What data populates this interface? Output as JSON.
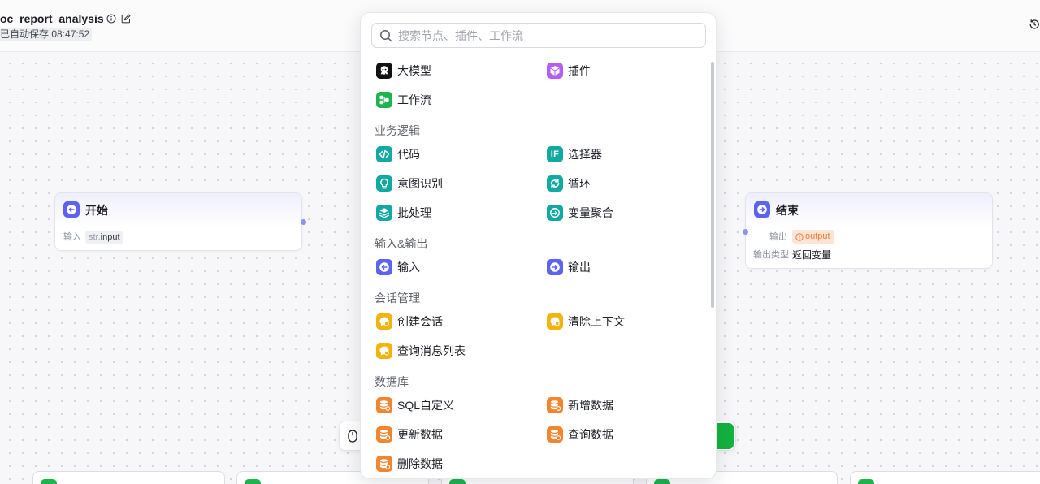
{
  "header": {
    "title": "oc_report_analysis",
    "autosave": "已自动保存 08:47:52",
    "icons": [
      "info-icon",
      "edit-icon",
      "history-icon"
    ]
  },
  "colors": {
    "llm": "#111111",
    "plugin": "#b65ef2",
    "workflow": "#1db34f",
    "logic": "#12a8a4",
    "io": "#5d62f0",
    "conversation": "#f2b30d",
    "database": "#f2852e",
    "run_button": "#12b33f",
    "warning": "#ef7b33"
  },
  "canvas": {
    "start_node": {
      "title": "开始",
      "input_label": "输入",
      "input_type": "str.",
      "input_name": "input"
    },
    "end_node": {
      "title": "结束",
      "output_label": "输出",
      "output_var": "output",
      "output_type_label": "输出类型",
      "output_type_value": "返回变量"
    },
    "toolbar_icons": [
      "mouse-icon"
    ]
  },
  "node_picker": {
    "search_placeholder": "搜索节点、插件、工作流",
    "top_items": [
      {
        "label": "大模型",
        "icon": "llm-icon"
      },
      {
        "label": "插件",
        "icon": "plugin-icon"
      },
      {
        "label": "工作流",
        "icon": "workflow-icon"
      }
    ],
    "sections": [
      {
        "title": "业务逻辑",
        "items": [
          {
            "label": "代码",
            "icon": "code-icon"
          },
          {
            "label": "选择器",
            "icon": "if-selector-icon",
            "icon_text": "IF"
          },
          {
            "label": "意图识别",
            "icon": "intent-icon"
          },
          {
            "label": "循环",
            "icon": "loop-icon"
          },
          {
            "label": "批处理",
            "icon": "batch-icon"
          },
          {
            "label": "变量聚合",
            "icon": "variable-merge-icon"
          }
        ]
      },
      {
        "title": "输入&输出",
        "items": [
          {
            "label": "输入",
            "icon": "input-icon"
          },
          {
            "label": "输出",
            "icon": "output-icon"
          }
        ]
      },
      {
        "title": "会话管理",
        "items": [
          {
            "label": "创建会话",
            "icon": "create-conversation-icon"
          },
          {
            "label": "清除上下文",
            "icon": "clear-context-icon"
          },
          {
            "label": "查询消息列表",
            "icon": "query-messages-icon"
          }
        ]
      },
      {
        "title": "数据库",
        "items": [
          {
            "label": "SQL自定义",
            "icon": "sql-database-icon"
          },
          {
            "label": "新增数据",
            "icon": "insert-data-icon"
          },
          {
            "label": "更新数据",
            "icon": "update-data-icon"
          },
          {
            "label": "查询数据",
            "icon": "query-data-icon"
          },
          {
            "label": "删除数据",
            "icon": "delete-data-icon"
          }
        ]
      }
    ]
  }
}
